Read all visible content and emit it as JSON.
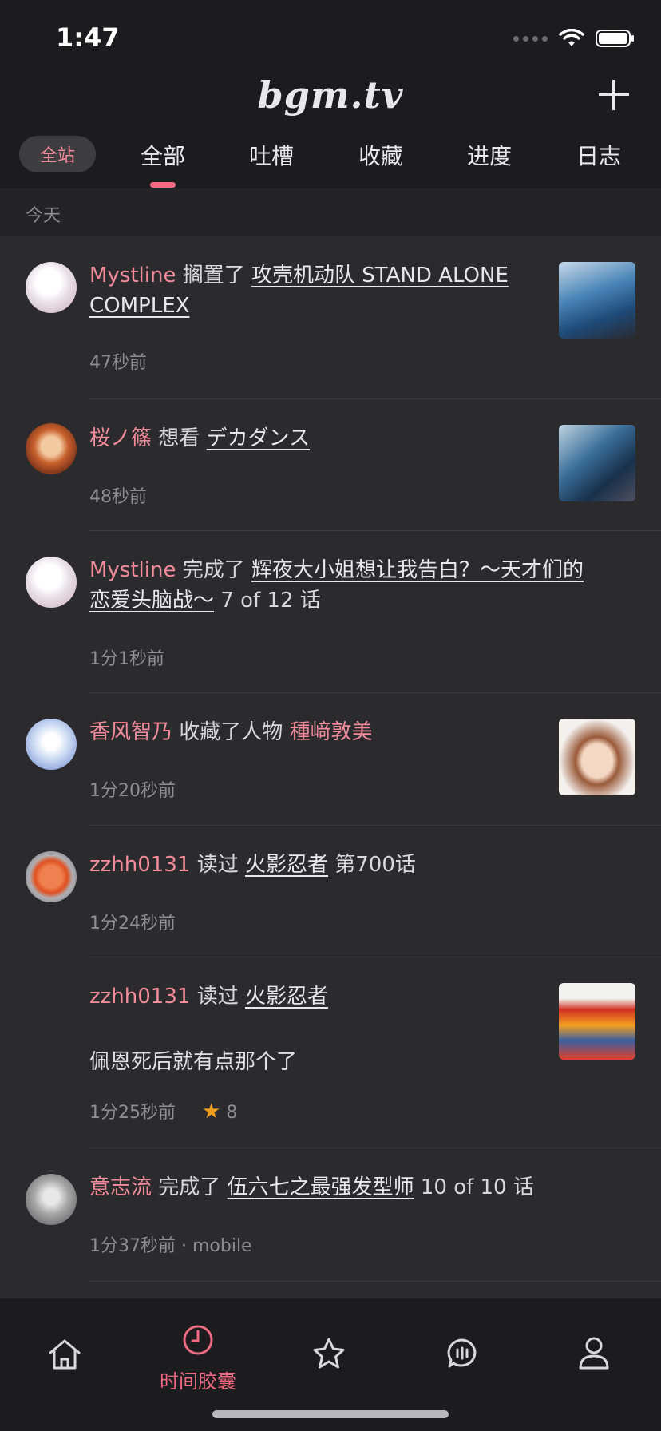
{
  "status_bar": {
    "time": "1:47"
  },
  "header": {
    "logo": "bgm.tv"
  },
  "scope": {
    "label": "全站"
  },
  "tabs": [
    {
      "label": "全部",
      "active": true
    },
    {
      "label": "吐槽"
    },
    {
      "label": "收藏"
    },
    {
      "label": "进度"
    },
    {
      "label": "日志"
    }
  ],
  "section": {
    "title": "今天"
  },
  "timeline": [
    {
      "user": "Mystline",
      "action": "搁置了",
      "subject_1": "攻壳机动队 STAND ALONE",
      "subject_2": "COMPLEX",
      "time": "47秒前"
    },
    {
      "user": "桜ノ篠",
      "action": "想看",
      "subject": "デカダンス",
      "time": "48秒前"
    },
    {
      "user": "Mystline",
      "action": "完成了",
      "subject_1": "辉夜大小姐想让我告白？～天才们的",
      "subject_2": "恋爱头脑战～",
      "extra": "7 of 12 话",
      "time": "1分1秒前"
    },
    {
      "user": "香风智乃",
      "action": "收藏了人物",
      "character": "種﨑敦美",
      "time": "1分20秒前"
    },
    {
      "user": "zzhh0131",
      "action": "读过",
      "subject": "火影忍者",
      "extra": "第700话",
      "time": "1分24秒前"
    },
    {
      "user": "zzhh0131",
      "action": "读过",
      "subject": "火影忍者",
      "comment": "佩恩死后就有点那个了",
      "time": "1分25秒前",
      "rating": "8"
    },
    {
      "user": "意志流",
      "action": "完成了",
      "subject": "伍六七之最强发型师",
      "extra": "10 of 10 话",
      "time": "1分37秒前 · mobile"
    }
  ],
  "bottom_nav": {
    "active_label": "时间胶囊"
  },
  "colors": {
    "accent": "#f06a82",
    "user": "#f28b9a",
    "background": "#2b2b2d",
    "star": "#f0a020"
  }
}
